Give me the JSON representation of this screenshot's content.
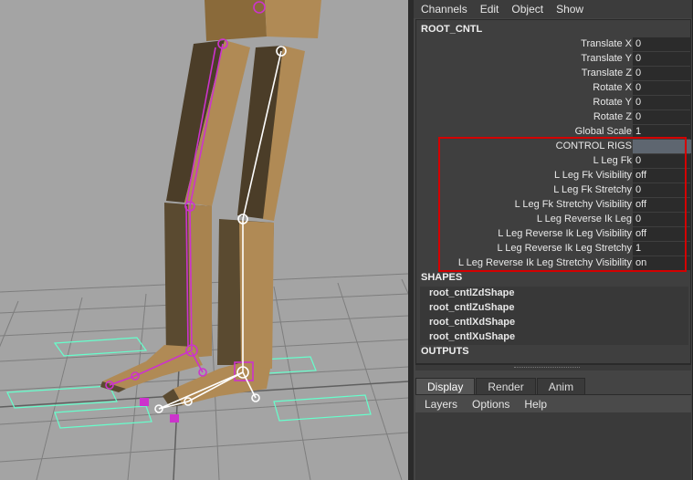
{
  "menubar": [
    "Channels",
    "Edit",
    "Object",
    "Show"
  ],
  "object_name": "ROOT_CNTL",
  "attributes": [
    {
      "label": "Translate X",
      "value": "0"
    },
    {
      "label": "Translate Y",
      "value": "0"
    },
    {
      "label": "Translate Z",
      "value": "0"
    },
    {
      "label": "Rotate X",
      "value": "0"
    },
    {
      "label": "Rotate Y",
      "value": "0"
    },
    {
      "label": "Rotate Z",
      "value": "0"
    },
    {
      "label": "Global Scale",
      "value": "1"
    },
    {
      "label": "CONTROL RIGS",
      "value": ""
    },
    {
      "label": "L Leg Fk",
      "value": "0"
    },
    {
      "label": "L Leg Fk Visibility",
      "value": "off"
    },
    {
      "label": "L Leg Fk Stretchy",
      "value": "0"
    },
    {
      "label": "L Leg Fk Stretchy Visibility",
      "value": "off"
    },
    {
      "label": "L Leg Reverse Ik Leg",
      "value": "0"
    },
    {
      "label": "L Leg Reverse Ik Leg Visibility",
      "value": "off"
    },
    {
      "label": "L Leg Reverse Ik Leg Stretchy",
      "value": "1"
    },
    {
      "label": "L Leg Reverse Ik Leg Stretchy Visibility",
      "value": "on"
    }
  ],
  "shapes_header": "SHAPES",
  "shapes": [
    "root_cntlZdShape",
    "root_cntlZuShape",
    "root_cntlXdShape",
    "root_cntlXuShape"
  ],
  "outputs_header": "OUTPUTS",
  "tabs": [
    "Display",
    "Render",
    "Anim"
  ],
  "layer_menu": [
    "Layers",
    "Options",
    "Help"
  ],
  "colors": {
    "viewport_bg": "#a4a4a4",
    "panel_bg": "#444444",
    "highlight": "#d40000",
    "rig_magenta": "#cc33cc",
    "control_curve": "#66ffcc",
    "leg_skin": "#b08a55"
  }
}
